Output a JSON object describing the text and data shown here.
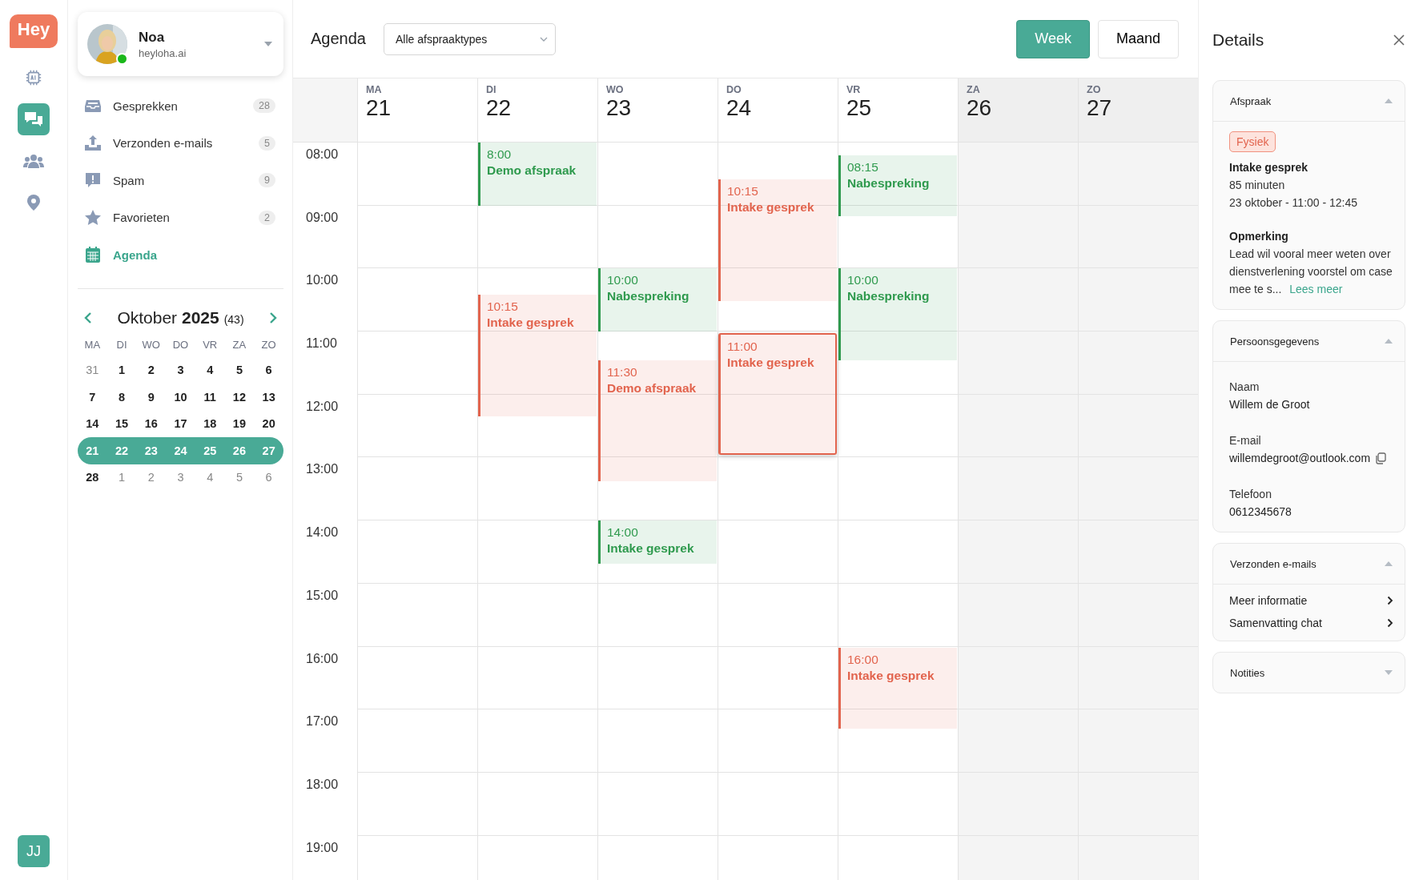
{
  "rail": {
    "logo": "Hey",
    "items": [
      {
        "selected": false
      },
      {
        "selected": true
      },
      {
        "selected": false
      },
      {
        "selected": false
      }
    ],
    "user_initials": "JJ"
  },
  "profile": {
    "name": "Noa",
    "domain": "heyloha.ai",
    "online": true
  },
  "nav": [
    {
      "label": "Gesprekken",
      "count": "28",
      "selected": false
    },
    {
      "label": "Verzonden e-mails",
      "count": "5",
      "selected": false
    },
    {
      "label": "Spam",
      "count": "9",
      "selected": false
    },
    {
      "label": "Favorieten",
      "count": "2",
      "selected": false
    },
    {
      "label": "Agenda",
      "selected": true
    }
  ],
  "mini_calendar": {
    "title": "Oktober **2025**",
    "week": "(43)",
    "weekdays": [
      "MA",
      "DI",
      "WO",
      "DO",
      "VR",
      "ZA",
      "ZO"
    ],
    "weeks": [
      {
        "selected": false,
        "days": [
          {
            "day": "31",
            "muted": true
          },
          {
            "day": "1",
            "muted": false
          },
          {
            "day": "2",
            "muted": false
          },
          {
            "day": "3",
            "muted": false
          },
          {
            "day": "4",
            "muted": false
          },
          {
            "day": "5",
            "muted": false
          },
          {
            "day": "6",
            "muted": false
          }
        ]
      },
      {
        "selected": false,
        "days": [
          {
            "day": "7",
            "muted": false
          },
          {
            "day": "8",
            "muted": false
          },
          {
            "day": "9",
            "muted": false
          },
          {
            "day": "10",
            "muted": false
          },
          {
            "day": "11",
            "muted": false
          },
          {
            "day": "12",
            "muted": false
          },
          {
            "day": "13",
            "muted": false
          }
        ]
      },
      {
        "selected": false,
        "days": [
          {
            "day": "14",
            "muted": false
          },
          {
            "day": "15",
            "muted": false
          },
          {
            "day": "16",
            "muted": false
          },
          {
            "day": "17",
            "muted": false
          },
          {
            "day": "18",
            "muted": false
          },
          {
            "day": "19",
            "muted": false
          },
          {
            "day": "20",
            "muted": false
          }
        ]
      },
      {
        "selected": true,
        "days": [
          {
            "day": "21",
            "muted": false
          },
          {
            "day": "22",
            "muted": false
          },
          {
            "day": "23",
            "muted": false
          },
          {
            "day": "24",
            "muted": false
          },
          {
            "day": "25",
            "muted": false
          },
          {
            "day": "26",
            "muted": false
          },
          {
            "day": "27",
            "muted": false
          }
        ]
      },
      {
        "selected": false,
        "days": [
          {
            "day": "28",
            "muted": false
          },
          {
            "day": "1",
            "muted": true
          },
          {
            "day": "2",
            "muted": true
          },
          {
            "day": "3",
            "muted": true
          },
          {
            "day": "4",
            "muted": true
          },
          {
            "day": "5",
            "muted": true
          },
          {
            "day": "6",
            "muted": true
          }
        ]
      }
    ]
  },
  "agenda": {
    "title": "Agenda",
    "filter": "Alle afspraaktypes",
    "views": [
      {
        "label": "Week",
        "selected": true
      },
      {
        "label": "Maand",
        "selected": false
      }
    ],
    "hours": [
      "08:00",
      "09:00",
      "10:00",
      "11:00",
      "12:00",
      "13:00",
      "14:00",
      "15:00",
      "16:00",
      "17:00",
      "18:00",
      "19:00"
    ],
    "days": [
      {
        "weekday": "MA",
        "date": "21",
        "weekend": false
      },
      {
        "weekday": "DI",
        "date": "22",
        "weekend": false,
        "events": [
          {
            "time": "8:00",
            "title": "Demo afspraak",
            "color": "#2f9a4e",
            "selected": false
          },
          {
            "time": "10:15",
            "title": "Intake gesprek",
            "color": "#e2644e",
            "selected": false
          }
        ]
      },
      {
        "weekday": "WO",
        "date": "23",
        "weekend": false,
        "events": [
          {
            "time": "10:00",
            "title": "Nabespreking",
            "color": "#2f9a4e",
            "selected": false
          },
          {
            "time": "11:30",
            "title": "Demo afspraak",
            "color": "#e2644e",
            "selected": false
          },
          {
            "time": "14:00",
            "title": "Intake gesprek",
            "color": "#2f9a4e",
            "selected": false
          }
        ]
      },
      {
        "weekday": "DO",
        "date": "24",
        "weekend": false,
        "events": [
          {
            "time": "10:15",
            "title": "Intake gesprek",
            "color": "#e2644e",
            "selected": false
          },
          {
            "time": "11:00",
            "title": "Intake gesprek",
            "color": "#e2644e",
            "selected": true
          }
        ]
      },
      {
        "weekday": "VR",
        "date": "25",
        "weekend": false,
        "events": [
          {
            "time": "08:15",
            "title": "Nabespreking",
            "color": "#2f9a4e",
            "selected": false
          },
          {
            "time": "10:00",
            "title": "Nabespreking",
            "color": "#2f9a4e",
            "selected": false
          },
          {
            "time": "16:00",
            "title": "Intake gesprek",
            "color": "#e2644e",
            "selected": false
          }
        ]
      },
      {
        "weekday": "ZA",
        "date": "26",
        "weekend": true
      },
      {
        "weekday": "ZO",
        "date": "27",
        "weekend": true
      }
    ]
  },
  "details": {
    "title": "Details",
    "appointment": {
      "heading": "Afspraak",
      "expanded": true,
      "tag": "Fysiek",
      "name": "Intake gesprek",
      "duration": "85 minuten",
      "when": "23 oktober - 11:00 - 12:45",
      "note_label": "Opmerking",
      "note": "Lead wil vooral meer weten over dienstverlening voorstel om case mee te s...",
      "more_link": "Lees meer"
    },
    "person": {
      "heading": "Persoonsgegevens",
      "expanded": true,
      "fields": [
        {
          "label": "Naam",
          "value": "Willem de Groot",
          "copy": false
        },
        {
          "label": "E-mail",
          "value": "willemdegroot@outlook.com",
          "copy": true
        },
        {
          "label": "Telefoon",
          "value": "0612345678",
          "copy": false
        }
      ]
    },
    "emails": {
      "heading": "Verzonden e-mails",
      "expanded": true,
      "items": [
        "Meer informatie",
        "Samenvatting chat"
      ]
    },
    "notes": {
      "heading": "Notities",
      "expanded": false
    }
  }
}
